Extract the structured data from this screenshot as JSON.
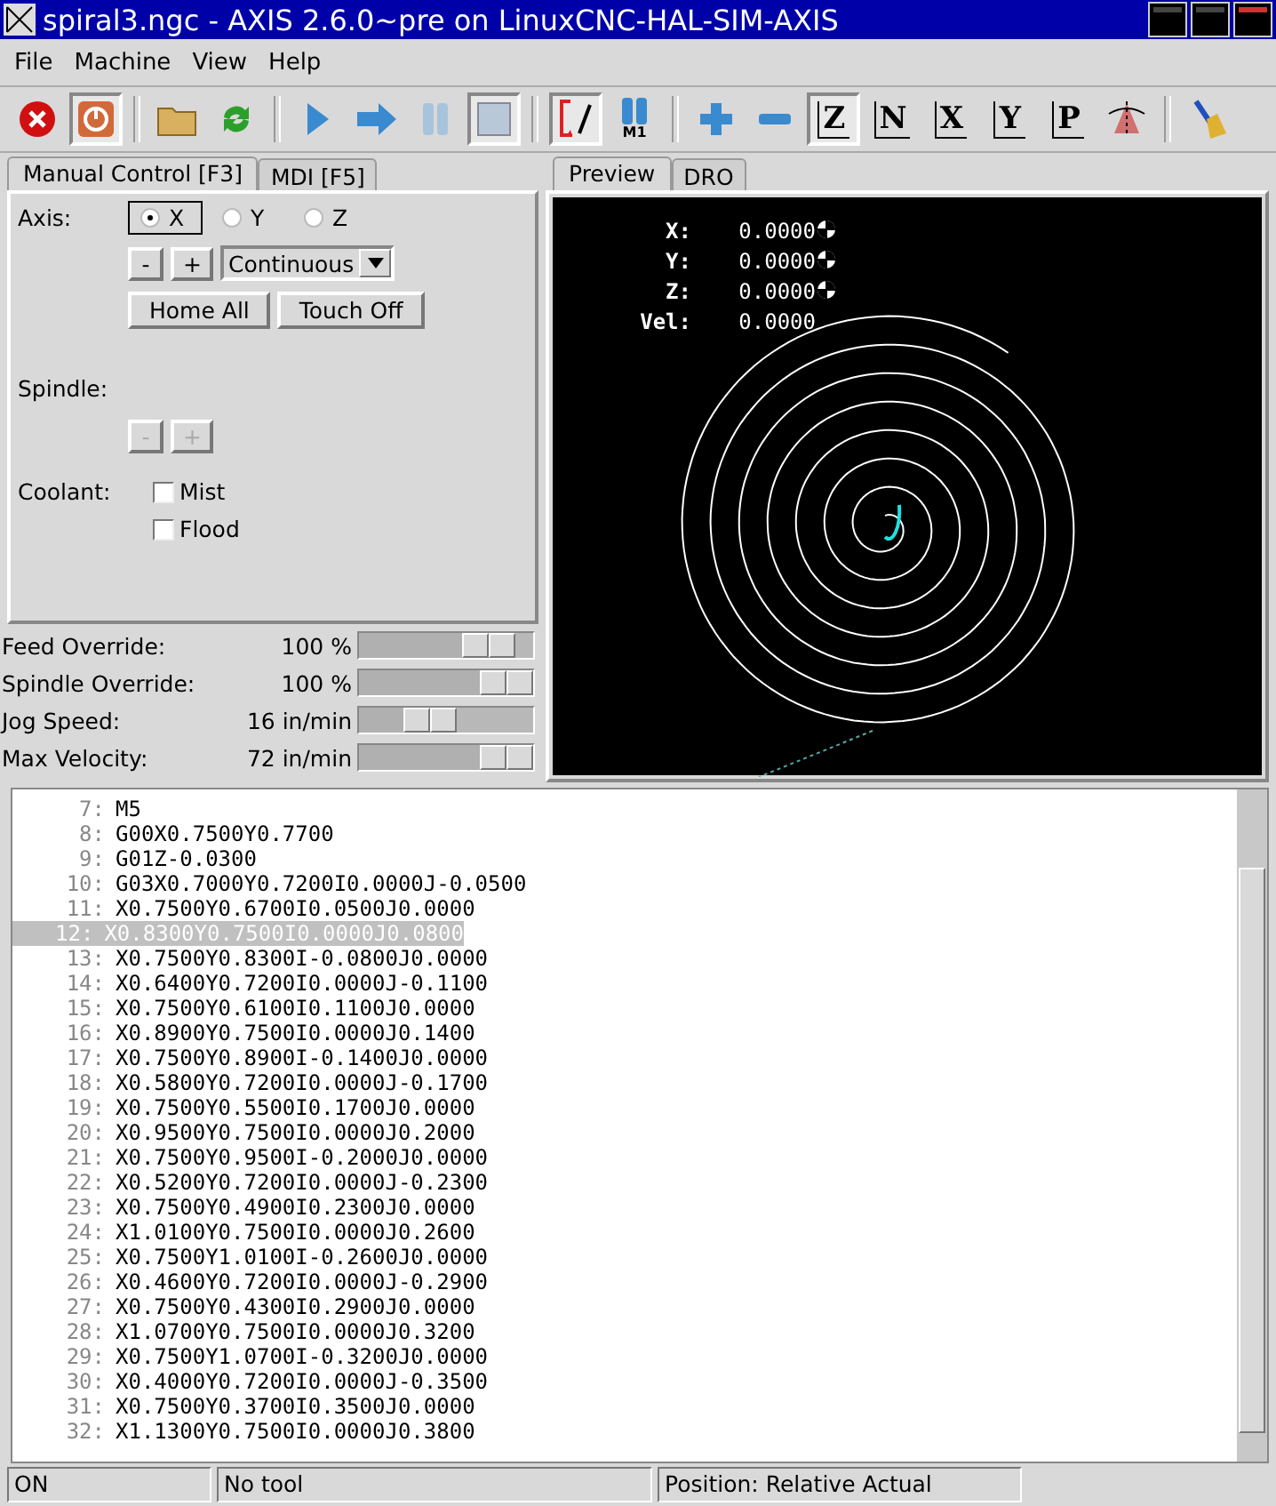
{
  "window": {
    "title": "spiral3.ngc - AXIS 2.6.0~pre on LinuxCNC-HAL-SIM-AXIS"
  },
  "menu": [
    "File",
    "Machine",
    "View",
    "Help"
  ],
  "toolbar": [
    {
      "kind": "estop",
      "pressed": false
    },
    {
      "kind": "power",
      "pressed": true
    },
    {
      "kind": "sep"
    },
    {
      "kind": "open",
      "pressed": false
    },
    {
      "kind": "reload",
      "pressed": false
    },
    {
      "kind": "sep"
    },
    {
      "kind": "run",
      "pressed": false
    },
    {
      "kind": "step",
      "pressed": false
    },
    {
      "kind": "pause",
      "pressed": false
    },
    {
      "kind": "stop",
      "pressed": true
    },
    {
      "kind": "sep"
    },
    {
      "kind": "blockdelete",
      "pressed": true
    },
    {
      "kind": "optstop",
      "label": "M1",
      "pressed": false
    },
    {
      "kind": "sep"
    },
    {
      "kind": "zoomin",
      "pressed": false
    },
    {
      "kind": "zoomout",
      "pressed": false
    },
    {
      "kind": "view",
      "label": "Z",
      "pressed": true
    },
    {
      "kind": "view",
      "label": "N",
      "pressed": false
    },
    {
      "kind": "view",
      "label": "X",
      "pressed": false
    },
    {
      "kind": "view",
      "label": "Y",
      "pressed": false
    },
    {
      "kind": "view",
      "label": "P",
      "pressed": false
    },
    {
      "kind": "rotate",
      "pressed": false
    },
    {
      "kind": "sep"
    },
    {
      "kind": "clear",
      "pressed": false
    }
  ],
  "left_tabs": [
    {
      "label": "Manual Control [F3]",
      "selected": true
    },
    {
      "label": "MDI [F5]",
      "selected": false
    }
  ],
  "manual": {
    "axis_label": "Axis:",
    "axes": [
      {
        "label": "X",
        "selected": true
      },
      {
        "label": "Y",
        "selected": false
      },
      {
        "label": "Z",
        "selected": false
      }
    ],
    "jog_minus": "-",
    "jog_plus": "+",
    "jog_mode": "Continuous",
    "home_all": "Home All",
    "touch_off": "Touch Off",
    "spindle_label": "Spindle:",
    "spindle_buttons": [
      {
        "label": "-",
        "disabled": true
      },
      {
        "label": "+",
        "disabled": true
      }
    ],
    "coolant_label": "Coolant:",
    "coolant": [
      {
        "label": "Mist",
        "checked": false
      },
      {
        "label": "Flood",
        "checked": false
      }
    ]
  },
  "sliders": [
    {
      "label": "Feed Override:",
      "reading": "100 %",
      "level": 0.9
    },
    {
      "label": "Spindle Override:",
      "reading": "100 %",
      "level": 1.0
    },
    {
      "label": "Jog Speed:",
      "reading": "16 in/min",
      "level": 0.56
    },
    {
      "label": "Max Velocity:",
      "reading": "72 in/min",
      "level": 1.0
    }
  ],
  "right_tabs": [
    {
      "label": "Preview",
      "selected": true
    },
    {
      "label": "DRO",
      "selected": false
    }
  ],
  "dro": [
    {
      "label": "X:",
      "value": "0.0000",
      "homed": true
    },
    {
      "label": "Y:",
      "value": "0.0000",
      "homed": true
    },
    {
      "label": "Z:",
      "value": "0.0000",
      "homed": true
    },
    {
      "label": "Vel:",
      "value": "0.0000",
      "homed": false
    }
  ],
  "code": [
    {
      "number": "7:",
      "text": "M5",
      "selected": false
    },
    {
      "number": "8:",
      "text": "G00X0.7500Y0.7700",
      "selected": false
    },
    {
      "number": "9:",
      "text": "G01Z-0.0300",
      "selected": false
    },
    {
      "number": "10:",
      "text": "G03X0.7000Y0.7200I0.0000J-0.0500",
      "selected": false
    },
    {
      "number": "11:",
      "text": "X0.7500Y0.6700I0.0500J0.0000",
      "selected": false
    },
    {
      "number": "12:",
      "text": "X0.8300Y0.7500I0.0000J0.0800",
      "selected": true
    },
    {
      "number": "13:",
      "text": "X0.7500Y0.8300I-0.0800J0.0000",
      "selected": false
    },
    {
      "number": "14:",
      "text": "X0.6400Y0.7200I0.0000J-0.1100",
      "selected": false
    },
    {
      "number": "15:",
      "text": "X0.7500Y0.6100I0.1100J0.0000",
      "selected": false
    },
    {
      "number": "16:",
      "text": "X0.8900Y0.7500I0.0000J0.1400",
      "selected": false
    },
    {
      "number": "17:",
      "text": "X0.7500Y0.8900I-0.1400J0.0000",
      "selected": false
    },
    {
      "number": "18:",
      "text": "X0.5800Y0.7200I0.0000J-0.1700",
      "selected": false
    },
    {
      "number": "19:",
      "text": "X0.7500Y0.5500I0.1700J0.0000",
      "selected": false
    },
    {
      "number": "20:",
      "text": "X0.9500Y0.7500I0.0000J0.2000",
      "selected": false
    },
    {
      "number": "21:",
      "text": "X0.7500Y0.9500I-0.2000J0.0000",
      "selected": false
    },
    {
      "number": "22:",
      "text": "X0.5200Y0.7200I0.0000J-0.2300",
      "selected": false
    },
    {
      "number": "23:",
      "text": "X0.7500Y0.4900I0.2300J0.0000",
      "selected": false
    },
    {
      "number": "24:",
      "text": "X1.0100Y0.7500I0.0000J0.2600",
      "selected": false
    },
    {
      "number": "25:",
      "text": "X0.7500Y1.0100I-0.2600J0.0000",
      "selected": false
    },
    {
      "number": "26:",
      "text": "X0.4600Y0.7200I0.0000J-0.2900",
      "selected": false
    },
    {
      "number": "27:",
      "text": "X0.7500Y0.4300I0.2900J0.0000",
      "selected": false
    },
    {
      "number": "28:",
      "text": "X1.0700Y0.7500I0.0000J0.3200",
      "selected": false
    },
    {
      "number": "29:",
      "text": "X0.7500Y1.0700I-0.3200J0.0000",
      "selected": false
    },
    {
      "number": "30:",
      "text": "X0.4000Y0.7200I0.0000J-0.3500",
      "selected": false
    },
    {
      "number": "31:",
      "text": "X0.7500Y0.3700I0.3500J0.0000",
      "selected": false
    },
    {
      "number": "32:",
      "text": "X1.1300Y0.7500I0.0000J0.3800",
      "selected": false
    }
  ],
  "status_bar": [
    "ON",
    "No tool",
    "Position: Relative Actual"
  ]
}
